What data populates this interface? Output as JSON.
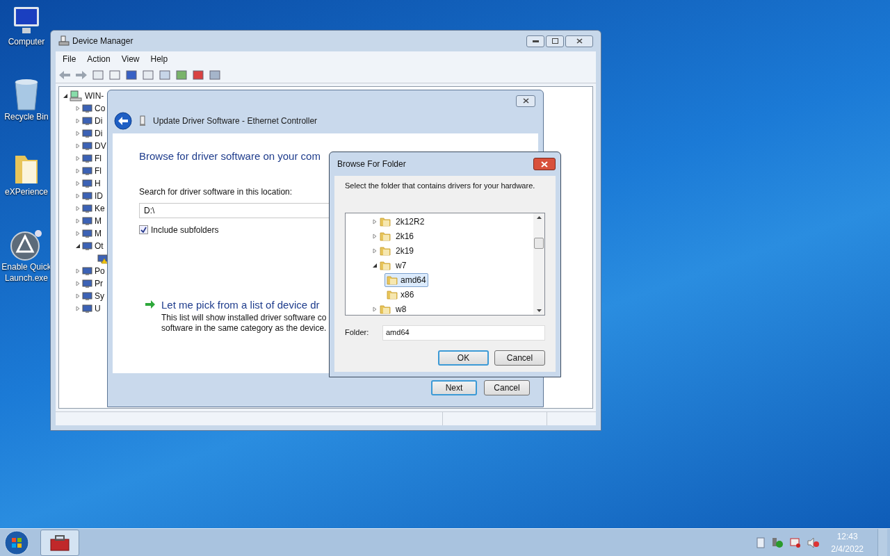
{
  "desktop_icons": [
    {
      "label": "Computer",
      "kind": "computer"
    },
    {
      "label": "Recycle Bin",
      "kind": "bin"
    },
    {
      "label": "eXPerience",
      "kind": "folder"
    },
    {
      "label": "Enable Quick Launch.exe",
      "kind": "app"
    }
  ],
  "device_manager": {
    "title": "Device Manager",
    "menu": [
      "File",
      "Action",
      "View",
      "Help"
    ],
    "tree": {
      "label": "WIN-",
      "expanded": true,
      "children": [
        {
          "label": "Co",
          "expanded": false
        },
        {
          "label": "Di",
          "expanded": false
        },
        {
          "label": "Di",
          "expanded": false
        },
        {
          "label": "DV",
          "expanded": false
        },
        {
          "label": "Fl",
          "expanded": false
        },
        {
          "label": "Fl",
          "expanded": false
        },
        {
          "label": "H",
          "expanded": false
        },
        {
          "label": "ID",
          "expanded": false
        },
        {
          "label": "Ke",
          "expanded": false
        },
        {
          "label": "M",
          "expanded": false
        },
        {
          "label": "M",
          "expanded": false
        },
        {
          "label": "Ot",
          "expanded": true,
          "children": [
            {
              "kind": "warning-device"
            }
          ]
        },
        {
          "label": "Po",
          "expanded": false
        },
        {
          "label": "Pr",
          "expanded": false
        },
        {
          "label": "Sy",
          "expanded": false
        },
        {
          "label": "U",
          "expanded": false
        }
      ]
    }
  },
  "update_driver": {
    "title": "Update Driver Software - Ethernet Controller",
    "heading": "Browse for driver software on your com",
    "location_label": "Search for driver software in this location:",
    "location_value": "D:\\",
    "include_subfolders": {
      "label": "Include subfolders",
      "checked": true
    },
    "pick_option": {
      "title": "Let me pick from a list of device dr",
      "description": [
        "This list will show installed driver software co",
        "software in the same category as the device."
      ]
    },
    "buttons": [
      {
        "label": "Next",
        "default": true
      },
      {
        "label": "Cancel",
        "default": false
      }
    ]
  },
  "browse_folder": {
    "title": "Browse For Folder",
    "instruction": "Select the folder that contains drivers for your hardware.",
    "tree": [
      {
        "label": "2k12R2",
        "expanded": false,
        "selected": false
      },
      {
        "label": "2k16",
        "expanded": false,
        "selected": false
      },
      {
        "label": "2k19",
        "expanded": false,
        "selected": false
      },
      {
        "label": "w7",
        "expanded": true,
        "selected": false,
        "children": [
          {
            "label": "amd64",
            "selected": true
          },
          {
            "label": "x86",
            "selected": false
          }
        ]
      },
      {
        "label": "w8",
        "expanded": false,
        "selected": false
      }
    ],
    "folder_label": "Folder:",
    "folder_value": "amd64",
    "buttons": [
      {
        "label": "OK",
        "default": true
      },
      {
        "label": "Cancel",
        "default": false
      }
    ]
  },
  "taskbar": {
    "time": "12:43",
    "date": "2/4/2022"
  }
}
